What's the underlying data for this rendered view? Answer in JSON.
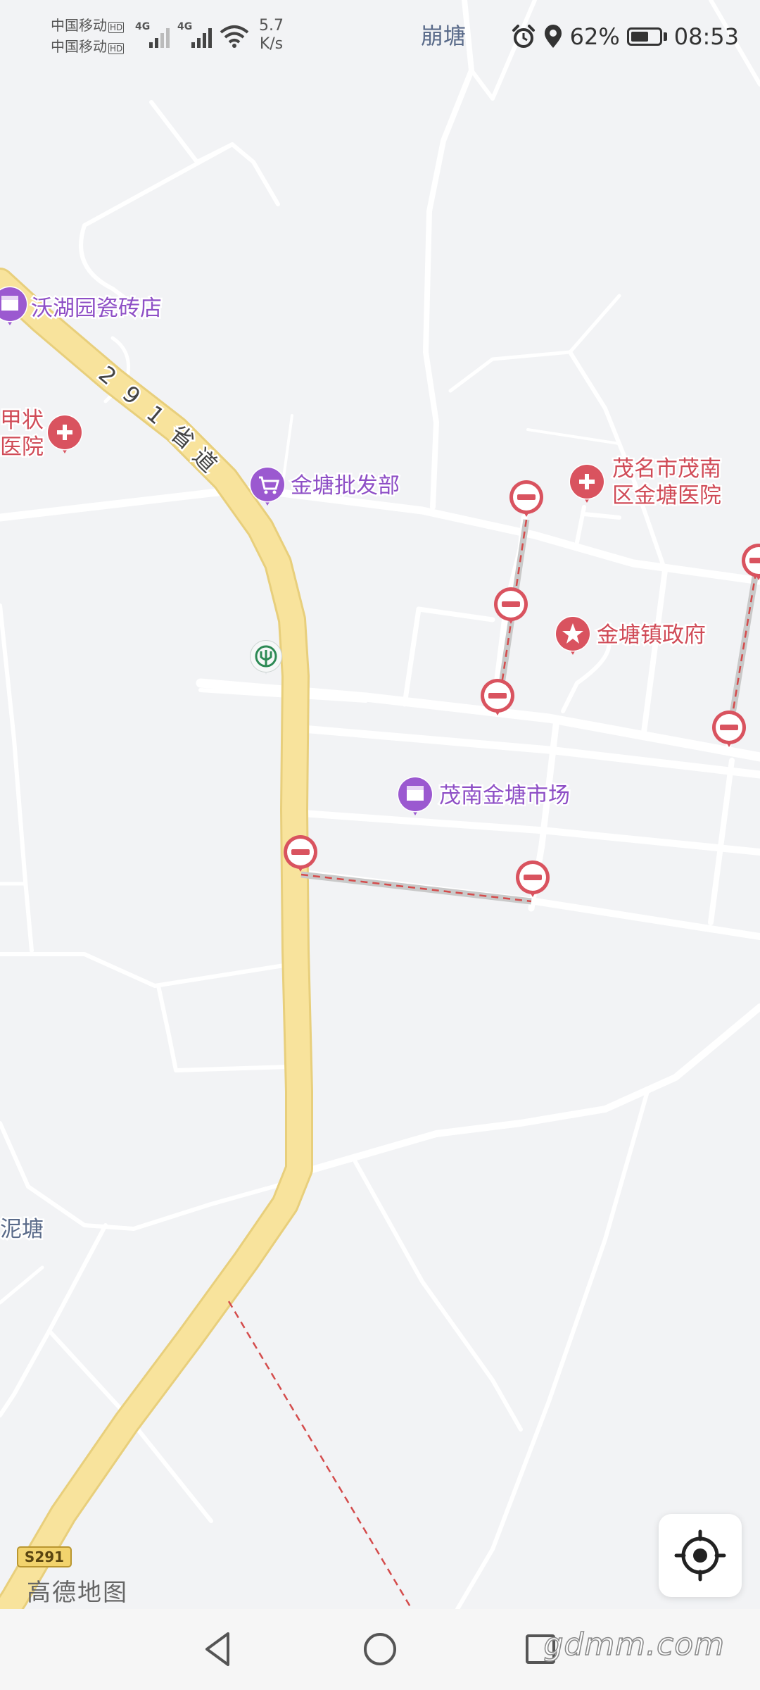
{
  "status_bar": {
    "carrier_1": "中国移动",
    "carrier_2": "中国移动",
    "net_1": "4G",
    "net_2": "4G",
    "hd_1": "HD",
    "hd_2": "HD",
    "speed_value": "5.7",
    "speed_unit": "K/s",
    "location": "崩塘",
    "battery": "62%",
    "battery_level": 0.62,
    "time": "08:53"
  },
  "map": {
    "road_label": "291省道",
    "road_label_chars": [
      "2",
      "9",
      "1",
      "省",
      "道"
    ],
    "road_shield": "S291",
    "brand": "高德地图",
    "colors": {
      "background": "#f2f3f5",
      "minor_road": "#ffffff",
      "provincial_road": "#f8e39c",
      "shop_poi": "#9b59d0",
      "red_poi": "#d9535f",
      "label_purple": "#8e4fc6",
      "label_red": "#d04b57"
    },
    "pois": {
      "tile_shop": "沃湖园瓷砖店",
      "partial_hospital_1": "甲状",
      "partial_hospital_2": "医院",
      "wholesale": "金塘批发部",
      "hospital_1": "茂名市茂南",
      "hospital_2": "区金塘医院",
      "gov": "金塘镇政府",
      "market": "茂南金塘市场",
      "village": "泥塘"
    }
  },
  "nav_bar": {
    "back_icon": "triangle-back",
    "home_icon": "circle-home",
    "recents_icon": "square-recents",
    "watermark": "gdmm.com"
  }
}
